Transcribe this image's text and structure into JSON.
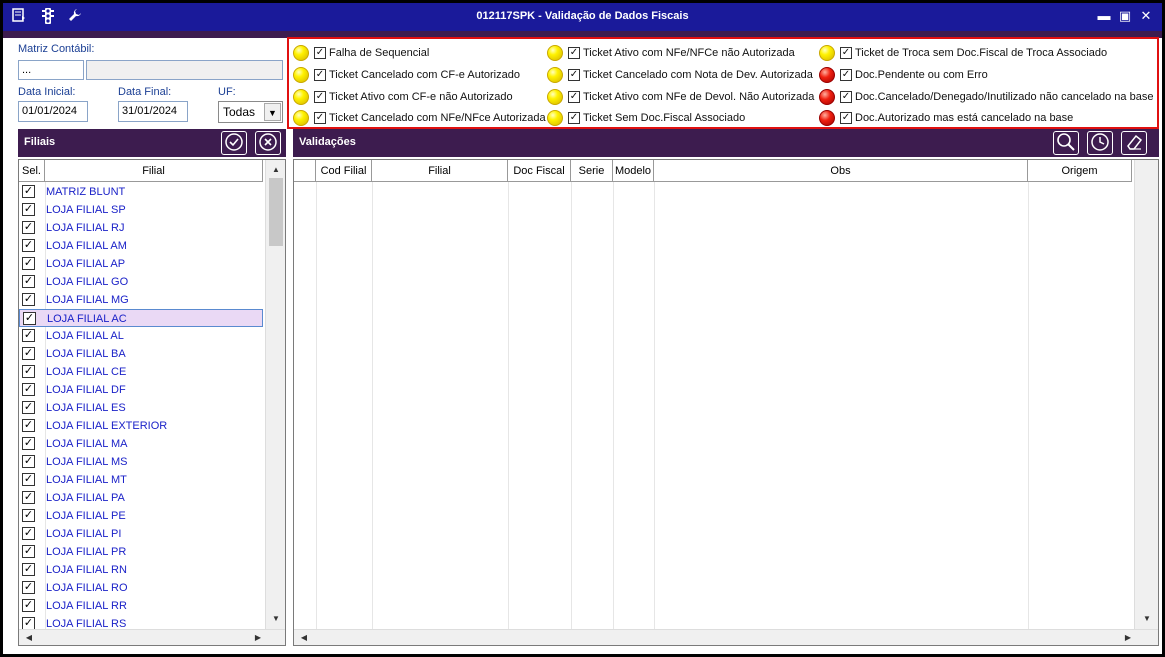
{
  "window": {
    "title": "012117SPK - Validação de Dados Fiscais",
    "icons": [
      "form-icon",
      "traffic-light-icon",
      "wrench-icon"
    ],
    "controls": [
      "minimize-icon",
      "maximize-icon",
      "close-icon"
    ]
  },
  "filters": {
    "matriz_label": "Matriz Contábil:",
    "matriz_value": "...",
    "data_inicial_label": "Data Inicial:",
    "data_inicial_value": "01/01/2024",
    "data_final_label": "Data Final:",
    "data_final_value": "31/01/2024",
    "uf_label": "UF:",
    "uf_value": "Todas"
  },
  "legend": {
    "col1": [
      {
        "color": "yellow",
        "label": "Falha de Sequencial"
      },
      {
        "color": "yellow",
        "label": "Ticket Cancelado com CF-e Autorizado"
      },
      {
        "color": "yellow",
        "label": "Ticket Ativo com CF-e não Autorizado"
      },
      {
        "color": "yellow",
        "label": "Ticket Cancelado com NFe/NFce Autorizada"
      }
    ],
    "col2": [
      {
        "color": "yellow",
        "label": "Ticket Ativo com NFe/NFCe não Autorizada"
      },
      {
        "color": "yellow",
        "label": "Ticket Cancelado com Nota de Dev. Autorizada"
      },
      {
        "color": "yellow",
        "label": "Ticket Ativo com NFe de Devol. Não Autorizada"
      },
      {
        "color": "yellow",
        "label": "Ticket Sem Doc.Fiscal Associado"
      }
    ],
    "col3": [
      {
        "color": "yellow",
        "label": "Ticket de Troca sem Doc.Fiscal de Troca Associado"
      },
      {
        "color": "red",
        "label": "Doc.Pendente ou com Erro"
      },
      {
        "color": "red",
        "label": "Doc.Cancelado/Denegado/Inutilizado não cancelado na base"
      },
      {
        "color": "red",
        "label": "Doc.Autorizado mas está cancelado na base"
      }
    ],
    "colors": {
      "yellow": "#fff200",
      "red": "#e01010"
    }
  },
  "filiais": {
    "title": "Filiais",
    "col_sel": "Sel.",
    "col_filial": "Filial",
    "items": [
      "MATRIZ BLUNT",
      "LOJA FILIAL SP",
      "LOJA FILIAL RJ",
      "LOJA FILIAL AM",
      "LOJA FILIAL AP",
      "LOJA FILIAL GO",
      "LOJA FILIAL MG",
      "LOJA FILIAL AC",
      "LOJA FILIAL AL",
      "LOJA FILIAL BA",
      "LOJA FILIAL CE",
      "LOJA FILIAL DF",
      "LOJA FILIAL ES",
      "LOJA FILIAL EXTERIOR",
      "LOJA FILIAL MA",
      "LOJA FILIAL MS",
      "LOJA FILIAL MT",
      "LOJA FILIAL PA",
      "LOJA FILIAL PE",
      "LOJA FILIAL PI",
      "LOJA FILIAL PR",
      "LOJA FILIAL RN",
      "LOJA FILIAL RO",
      "LOJA FILIAL RR",
      "LOJA FILIAL RS"
    ],
    "selected_index": 7
  },
  "validacoes": {
    "title": "Validações",
    "columns": [
      "Cod Filial",
      "Filial",
      "Doc Fiscal",
      "Serie",
      "Modelo",
      "Obs",
      "Origem"
    ]
  },
  "theme": {
    "titlebar": "#1a1a9a",
    "panel": "#3d1c4f",
    "legend_border": "#e01010",
    "link": "#1b22c8"
  }
}
